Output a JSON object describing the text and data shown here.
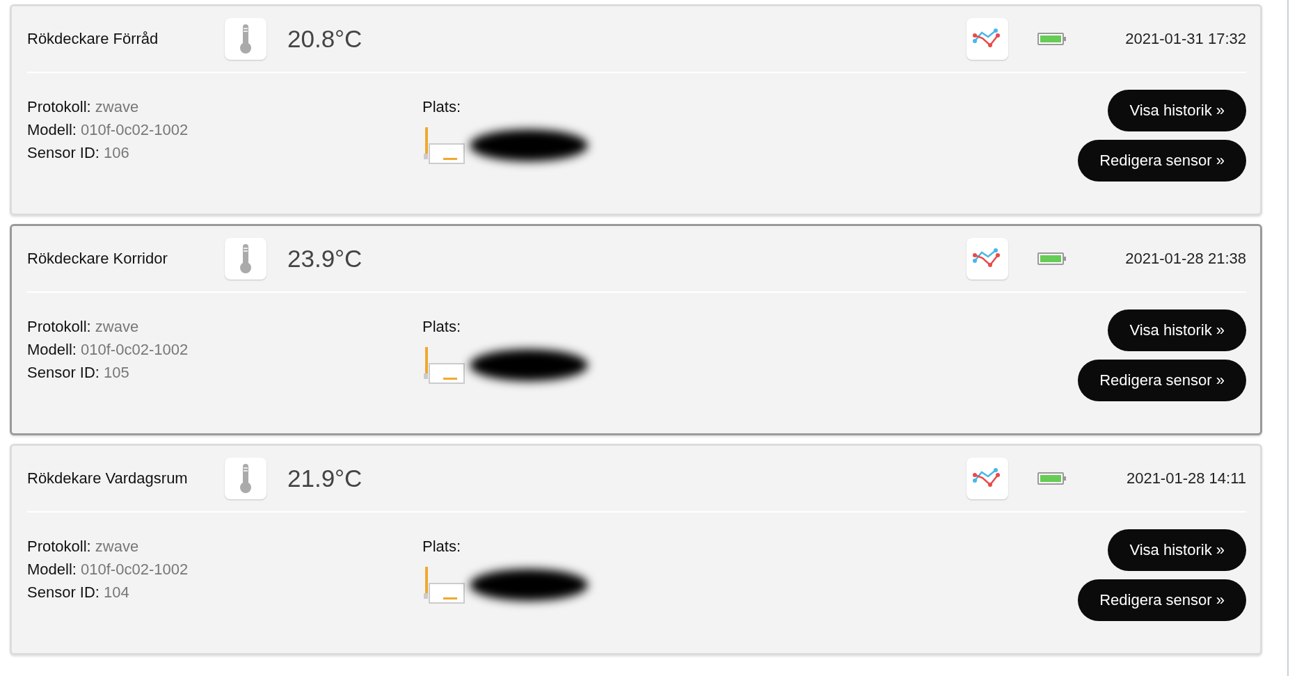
{
  "sensors": [
    {
      "name": "Rökdeckare Förråd",
      "temperature": "20.8°C",
      "timestamp": "2021-01-31 17:32",
      "selected": false,
      "details": [
        {
          "label": "Protokoll:",
          "value": "zwave"
        },
        {
          "label": "Modell:",
          "value": "010f-0c02-1002"
        },
        {
          "label": "Sensor ID:",
          "value": "106"
        }
      ],
      "location_label": "Plats:",
      "buttons": [
        "Visa historik »",
        "Redigera sensor »"
      ]
    },
    {
      "name": "Rökdeckare Korridor",
      "temperature": "23.9°C",
      "timestamp": "2021-01-28 21:38",
      "selected": true,
      "details": [
        {
          "label": "Protokoll:",
          "value": "zwave"
        },
        {
          "label": "Modell:",
          "value": "010f-0c02-1002"
        },
        {
          "label": "Sensor ID:",
          "value": "105"
        }
      ],
      "location_label": "Plats:",
      "buttons": [
        "Visa historik »",
        "Redigera sensor »"
      ]
    },
    {
      "name": "Rökdekare Vardagsrum",
      "temperature": "21.9°C",
      "timestamp": "2021-01-28 14:11",
      "selected": false,
      "details": [
        {
          "label": "Protokoll:",
          "value": "zwave"
        },
        {
          "label": "Modell:",
          "value": "010f-0c02-1002"
        },
        {
          "label": "Sensor ID:",
          "value": "104"
        }
      ],
      "location_label": "Plats:",
      "buttons": [
        "Visa historik »",
        "Redigera sensor »"
      ]
    }
  ]
}
